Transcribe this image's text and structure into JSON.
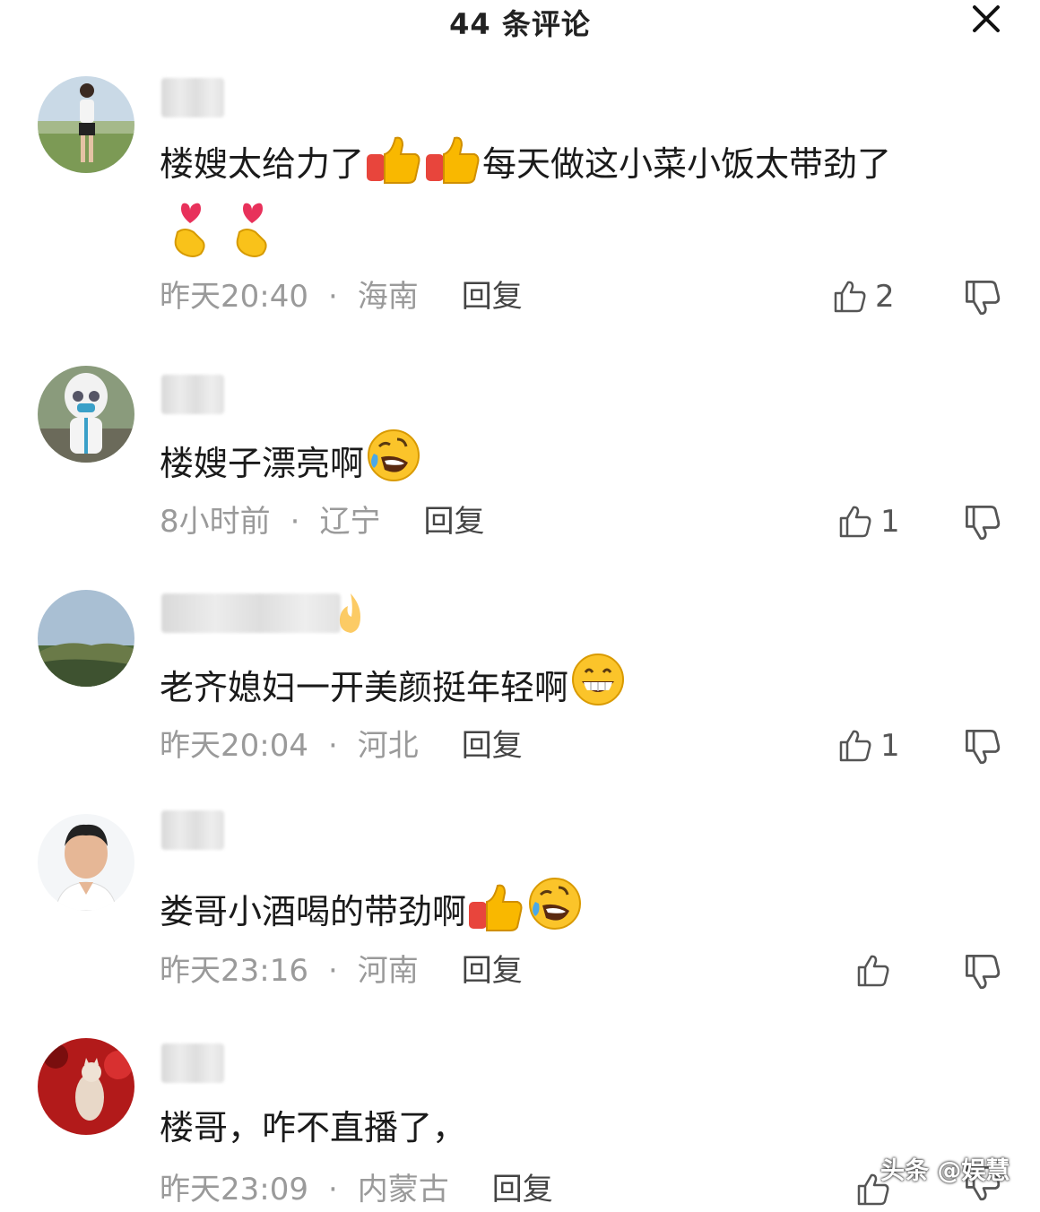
{
  "header": {
    "title": "44 条评论",
    "close_icon": "close-icon"
  },
  "colors": {
    "thumb_orange": "#f9b800",
    "thumb_red": "#e8453c",
    "heart_red": "#e8315b",
    "meta_gray": "#9a9a9a"
  },
  "comments": [
    {
      "text": "楼嫂太给力了",
      "text2": "每天做这小菜小饭太带劲了",
      "emojis": [
        "thumbs-up-icon",
        "thumbs-up-icon",
        "finger-heart-icon",
        "finger-heart-icon"
      ],
      "time": "昨天20:40",
      "region": "海南",
      "reply": "回复",
      "likes": "2"
    },
    {
      "text": "楼嫂子漂亮啊",
      "emojis": [
        "rolling-laughing-icon"
      ],
      "time": "8小时前",
      "region": "辽宁",
      "reply": "回复",
      "likes": "1"
    },
    {
      "text": "老齐媳妇一开美颜挺年轻啊",
      "emojis": [
        "grinning-face-icon"
      ],
      "time": "昨天20:04",
      "region": "河北",
      "reply": "回复",
      "likes": "1"
    },
    {
      "text": "娄哥小酒喝的带劲啊",
      "emojis": [
        "thumbs-up-icon",
        "rolling-laughing-icon"
      ],
      "time": "昨天23:16",
      "region": "河南",
      "reply": "回复",
      "likes": ""
    },
    {
      "text": "楼哥，咋不直播了，",
      "emojis": [],
      "time": "昨天23:09",
      "region": "内蒙古",
      "reply": "回复",
      "likes": ""
    }
  ],
  "watermark": "头条 @娱慧"
}
